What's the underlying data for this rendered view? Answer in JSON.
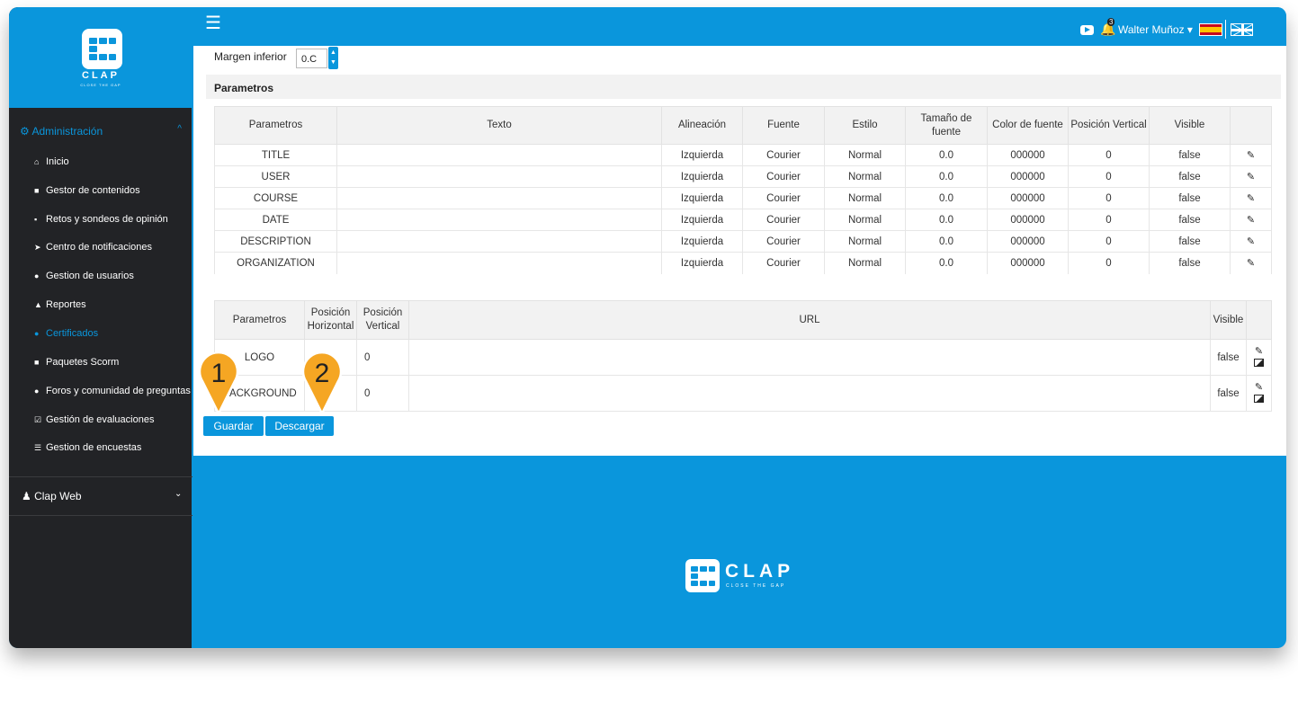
{
  "brand": {
    "name": "CLAP",
    "tagline": "CLOSE THE GAP"
  },
  "topbar": {
    "notifications": "3",
    "user": "Walter Muñoz ▾"
  },
  "sidebar": {
    "section": "Administración",
    "items": [
      {
        "label": "Inicio",
        "icon": "home-icon"
      },
      {
        "label": "Gestor de contenidos",
        "icon": "book-icon"
      },
      {
        "label": "Retos y sondeos de opinión",
        "icon": "sitemap-icon"
      },
      {
        "label": "Centro de notificaciones",
        "icon": "send-icon"
      },
      {
        "label": "Gestion de usuarios",
        "icon": "users-icon"
      },
      {
        "label": "Reportes",
        "icon": "chart-icon"
      },
      {
        "label": "Certificados",
        "icon": "circle-icon",
        "active": true
      },
      {
        "label": "Paquetes Scorm",
        "icon": "archive-icon"
      },
      {
        "label": "Foros y comunidad de preguntas",
        "icon": "comments-icon"
      },
      {
        "label": "Gestión de evaluaciones",
        "icon": "check-square-icon"
      },
      {
        "label": "Gestion de encuestas",
        "icon": "list-icon"
      }
    ],
    "footer": "Clap Web"
  },
  "form": {
    "margen_label": "Margen inferior",
    "margen_value": "0.C",
    "section_title": "Parametros"
  },
  "text_table": {
    "headers": [
      "Parametros",
      "Texto",
      "Alineación",
      "Fuente",
      "Estilo",
      "Tamaño de fuente",
      "Color de fuente",
      "Posición Vertical",
      "Visible",
      ""
    ],
    "rows": [
      [
        "TITLE",
        "",
        "Izquierda",
        "Courier",
        "Normal",
        "0.0",
        "000000",
        "0",
        "false"
      ],
      [
        "USER",
        "",
        "Izquierda",
        "Courier",
        "Normal",
        "0.0",
        "000000",
        "0",
        "false"
      ],
      [
        "COURSE",
        "",
        "Izquierda",
        "Courier",
        "Normal",
        "0.0",
        "000000",
        "0",
        "false"
      ],
      [
        "DATE",
        "",
        "Izquierda",
        "Courier",
        "Normal",
        "0.0",
        "000000",
        "0",
        "false"
      ],
      [
        "DESCRIPTION",
        "",
        "Izquierda",
        "Courier",
        "Normal",
        "0.0",
        "000000",
        "0",
        "false"
      ],
      [
        "ORGANIZATION",
        "",
        "Izquierda",
        "Courier",
        "Normal",
        "0.0",
        "000000",
        "0",
        "false"
      ]
    ]
  },
  "image_table": {
    "headers": [
      "Parametros",
      "Posición Horizontal",
      "Posición Vertical",
      "URL",
      "Visible",
      ""
    ],
    "rows": [
      [
        "LOGO",
        "",
        "0",
        "",
        "false"
      ],
      [
        "BACKGROUND",
        "",
        "0",
        "",
        "false"
      ]
    ]
  },
  "buttons": {
    "save": "Guardar",
    "download": "Descargar"
  },
  "markers": [
    "1",
    "2"
  ],
  "colors": {
    "primary": "#0a96dc",
    "sidebar": "#222326",
    "marker": "#f5a623"
  }
}
